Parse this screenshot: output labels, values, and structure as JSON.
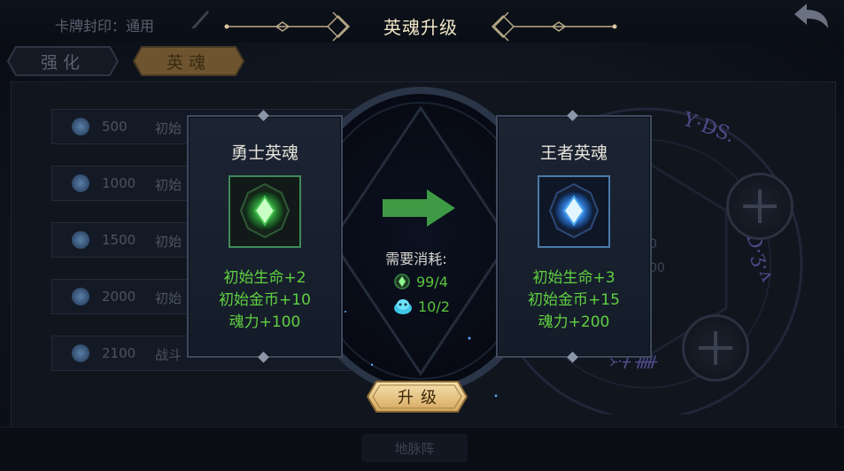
{
  "background": {
    "seal_text": "卡牌封印：通用",
    "tabs": [
      {
        "label": "强化",
        "active": false
      },
      {
        "label": "英魂",
        "active": true
      }
    ],
    "rows": [
      {
        "amount": "500",
        "desc": "初始"
      },
      {
        "amount": "1000",
        "desc": "初始"
      },
      {
        "amount": "1500",
        "desc": "初始"
      },
      {
        "amount": "2000",
        "desc": "初始"
      },
      {
        "amount": "2100",
        "desc": "战斗"
      }
    ],
    "side_numbers": [
      "0",
      "00"
    ],
    "bottom_button": "地脉阵"
  },
  "dialog": {
    "title": "英魂升级",
    "current": {
      "name": "勇士英魂",
      "icon": "green-soul-gem-icon",
      "stats": [
        "初始生命+2",
        "初始金币+10",
        "魂力+100"
      ]
    },
    "next": {
      "name": "王者英魂",
      "icon": "blue-soul-gem-icon",
      "stats": [
        "初始生命+3",
        "初始金币+15",
        "魂力+200"
      ]
    },
    "cost_label": "需要消耗:",
    "costs": [
      {
        "icon": "green-soul-shard-icon",
        "value": "99/4"
      },
      {
        "icon": "blue-slime-icon",
        "value": "10/2"
      }
    ],
    "upgrade_label": "升级"
  },
  "colors": {
    "stat_green": "#5ed040",
    "arrow_green": "#3f9a45",
    "button_gold": "#e8c98c",
    "title": "#f2e6c8"
  }
}
